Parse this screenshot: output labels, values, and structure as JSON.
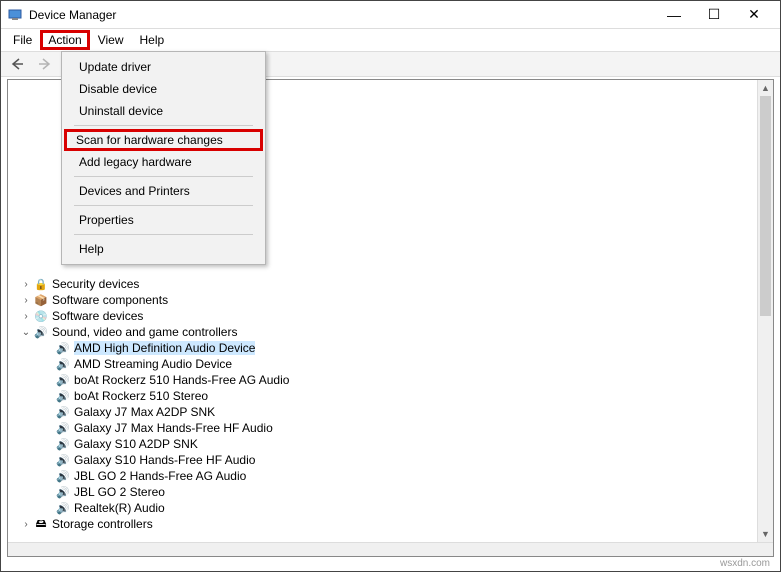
{
  "window": {
    "title": "Device Manager",
    "controls": {
      "min": "—",
      "max": "☐",
      "close": "✕"
    }
  },
  "menubar": {
    "file": "File",
    "action": "Action",
    "view": "View",
    "help": "Help"
  },
  "action_menu": {
    "update_driver": "Update driver",
    "disable_device": "Disable device",
    "uninstall_device": "Uninstall device",
    "scan_hardware": "Scan for hardware changes",
    "add_legacy": "Add legacy hardware",
    "devices_printers": "Devices and Printers",
    "properties": "Properties",
    "help": "Help"
  },
  "tree": {
    "security_devices": "Security devices",
    "software_components": "Software components",
    "software_devices": "Software devices",
    "sound_controllers": "Sound, video and game controllers",
    "storage_controllers": "Storage controllers",
    "sound_children": {
      "c0": "AMD High Definition Audio Device",
      "c1": "AMD Streaming Audio Device",
      "c2": "boAt Rockerz 510 Hands-Free AG Audio",
      "c3": "boAt Rockerz 510 Stereo",
      "c4": "Galaxy J7 Max A2DP SNK",
      "c5": "Galaxy J7 Max Hands-Free HF Audio",
      "c6": "Galaxy S10 A2DP SNK",
      "c7": "Galaxy S10 Hands-Free HF Audio",
      "c8": "JBL GO 2 Hands-Free AG Audio",
      "c9": "JBL GO 2 Stereo",
      "c10": "Realtek(R) Audio"
    }
  },
  "watermark": "wsxdn.com"
}
